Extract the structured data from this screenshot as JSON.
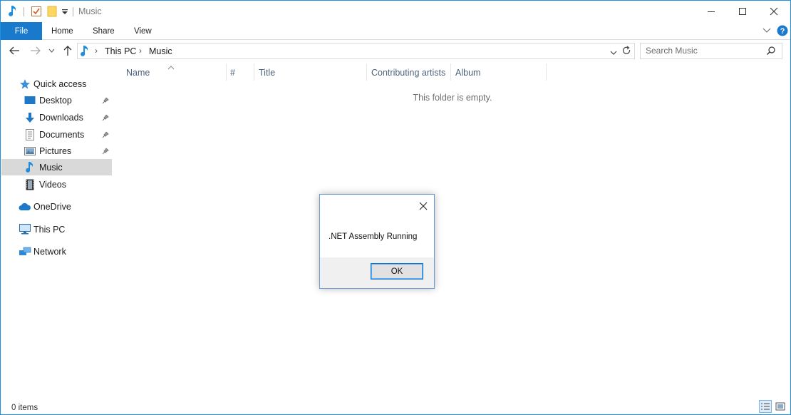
{
  "window": {
    "title": "Music"
  },
  "ribbon": {
    "tabs": [
      {
        "label": "File"
      },
      {
        "label": "Home"
      },
      {
        "label": "Share"
      },
      {
        "label": "View"
      }
    ]
  },
  "address": {
    "breadcrumbs": [
      "This PC",
      "Music"
    ]
  },
  "search": {
    "placeholder": "Search Music"
  },
  "sidebar": {
    "items": [
      {
        "label": "Quick access",
        "icon": "star-icon"
      },
      {
        "label": "Desktop",
        "icon": "desktop-icon",
        "pinned": true
      },
      {
        "label": "Downloads",
        "icon": "download-arrow-icon",
        "pinned": true
      },
      {
        "label": "Documents",
        "icon": "document-icon",
        "pinned": true
      },
      {
        "label": "Pictures",
        "icon": "picture-icon",
        "pinned": true
      },
      {
        "label": "Music",
        "icon": "music-note-icon",
        "selected": true
      },
      {
        "label": "Videos",
        "icon": "film-icon"
      },
      {
        "label": "OneDrive",
        "icon": "cloud-icon"
      },
      {
        "label": "This PC",
        "icon": "monitor-icon"
      },
      {
        "label": "Network",
        "icon": "network-icon"
      }
    ]
  },
  "columns": [
    "Name",
    "#",
    "Title",
    "Contributing artists",
    "Album"
  ],
  "content": {
    "empty_message": "This folder is empty."
  },
  "status": {
    "item_count": "0 items"
  },
  "dialog": {
    "message": ".NET Assembly Running",
    "ok_label": "OK"
  },
  "colors": {
    "accent": "#1979ca",
    "border": "#1e90e6",
    "selected_bg": "#d9d9d9",
    "music_icon": "#1e8ee0"
  }
}
